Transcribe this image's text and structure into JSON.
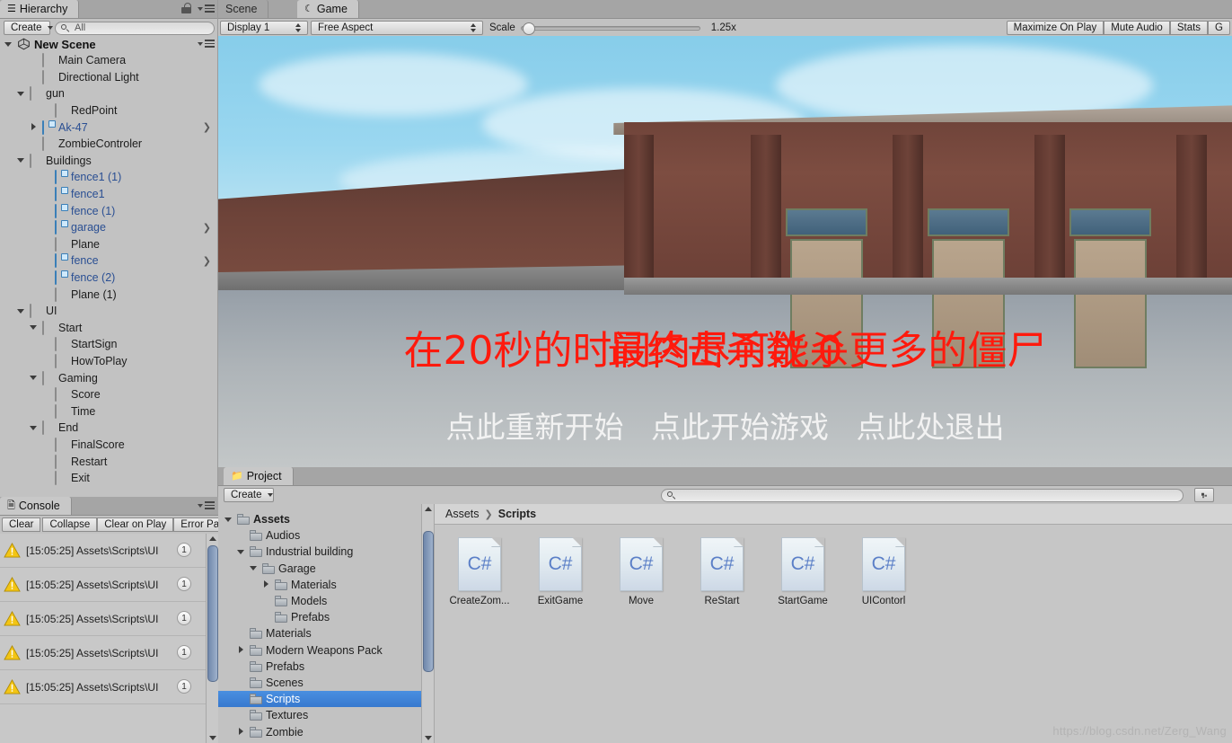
{
  "hierarchy": {
    "tab_label": "Hierarchy",
    "create_button": "Create",
    "search_placeholder": "All",
    "scene_name": "New Scene",
    "items": [
      {
        "label": "Main Camera",
        "depth": 2,
        "fold": "none",
        "icon": "gameobject-icon",
        "prefab": false,
        "chev": false
      },
      {
        "label": "Directional Light",
        "depth": 2,
        "fold": "none",
        "icon": "gameobject-icon",
        "prefab": false,
        "chev": false
      },
      {
        "label": "gun",
        "depth": 1,
        "fold": "open",
        "icon": "gameobject-icon",
        "prefab": false,
        "chev": false
      },
      {
        "label": "RedPoint",
        "depth": 3,
        "fold": "none",
        "icon": "gameobject-icon",
        "prefab": false,
        "chev": false
      },
      {
        "label": "Ak-47",
        "depth": 2,
        "fold": "closed",
        "icon": "prefab-icon",
        "prefab": true,
        "chev": true
      },
      {
        "label": "ZombieControler",
        "depth": 2,
        "fold": "none",
        "icon": "gameobject-icon",
        "prefab": false,
        "chev": false
      },
      {
        "label": "Buildings",
        "depth": 1,
        "fold": "open",
        "icon": "gameobject-icon",
        "prefab": false,
        "chev": false
      },
      {
        "label": "fence1 (1)",
        "depth": 3,
        "fold": "none",
        "icon": "prefab-icon",
        "prefab": true,
        "chev": false
      },
      {
        "label": "fence1",
        "depth": 3,
        "fold": "none",
        "icon": "prefab-icon",
        "prefab": true,
        "chev": false
      },
      {
        "label": "fence (1)",
        "depth": 3,
        "fold": "none",
        "icon": "prefab-icon",
        "prefab": true,
        "chev": false
      },
      {
        "label": "garage",
        "depth": 3,
        "fold": "none",
        "icon": "prefab-icon",
        "prefab": true,
        "chev": true
      },
      {
        "label": "Plane",
        "depth": 3,
        "fold": "none",
        "icon": "gameobject-icon",
        "prefab": false,
        "chev": false
      },
      {
        "label": "fence",
        "depth": 3,
        "fold": "none",
        "icon": "prefab-icon",
        "prefab": true,
        "chev": true
      },
      {
        "label": "fence (2)",
        "depth": 3,
        "fold": "none",
        "icon": "prefab-icon",
        "prefab": true,
        "chev": false
      },
      {
        "label": "Plane (1)",
        "depth": 3,
        "fold": "none",
        "icon": "gameobject-icon",
        "prefab": false,
        "chev": false
      },
      {
        "label": "UI",
        "depth": 1,
        "fold": "open",
        "icon": "gameobject-icon",
        "prefab": false,
        "chev": false
      },
      {
        "label": "Start",
        "depth": 2,
        "fold": "open",
        "icon": "gameobject-icon",
        "prefab": false,
        "chev": false
      },
      {
        "label": "StartSign",
        "depth": 3,
        "fold": "none",
        "icon": "gameobject-icon",
        "prefab": false,
        "chev": false
      },
      {
        "label": "HowToPlay",
        "depth": 3,
        "fold": "none",
        "icon": "gameobject-icon",
        "prefab": false,
        "chev": false
      },
      {
        "label": "Gaming",
        "depth": 2,
        "fold": "open",
        "icon": "gameobject-icon",
        "prefab": false,
        "chev": false
      },
      {
        "label": "Score",
        "depth": 3,
        "fold": "none",
        "icon": "gameobject-icon",
        "prefab": false,
        "chev": false
      },
      {
        "label": "Time",
        "depth": 3,
        "fold": "none",
        "icon": "gameobject-icon",
        "prefab": false,
        "chev": false
      },
      {
        "label": "End",
        "depth": 2,
        "fold": "open",
        "icon": "gameobject-icon",
        "prefab": false,
        "chev": false
      },
      {
        "label": "FinalScore",
        "depth": 3,
        "fold": "none",
        "icon": "gameobject-icon",
        "prefab": false,
        "chev": false
      },
      {
        "label": "Restart",
        "depth": 3,
        "fold": "none",
        "icon": "gameobject-icon",
        "prefab": false,
        "chev": false
      },
      {
        "label": "Exit",
        "depth": 3,
        "fold": "none",
        "icon": "gameobject-icon",
        "prefab": false,
        "chev": false
      }
    ]
  },
  "console": {
    "tab_label": "Console",
    "buttons": [
      "Clear",
      "Collapse",
      "Clear on Play",
      "Error Pause"
    ],
    "rows": [
      {
        "text": "[15:05:25] Assets\\Scripts\\UI",
        "count": "1",
        "type": "warning-icon"
      },
      {
        "text": "[15:05:25] Assets\\Scripts\\UI",
        "count": "1",
        "type": "warning-icon"
      },
      {
        "text": "[15:05:25] Assets\\Scripts\\UI",
        "count": "1",
        "type": "warning-icon"
      },
      {
        "text": "[15:05:25] Assets\\Scripts\\UI",
        "count": "1",
        "type": "warning-icon"
      },
      {
        "text": "[15:05:25] Assets\\Scripts\\UI",
        "count": "1",
        "type": "warning-icon"
      }
    ]
  },
  "gameview": {
    "tabs": [
      {
        "label": "Scene",
        "active": false,
        "icon": "scene-icon"
      },
      {
        "label": "Game",
        "active": true,
        "icon": "game-icon"
      }
    ],
    "display_select": "Display 1",
    "aspect_select": "Free Aspect",
    "scale_label": "Scale",
    "scale_value": "1.25x",
    "maximize_on_play": "Maximize On Play",
    "mute_audio": "Mute Audio",
    "stats": "Stats",
    "gizmos": "G",
    "overlay": {
      "line1_texts": [
        "在20秒的时间内尽可能杀更多的僵尸",
        "最终击杀数 0"
      ],
      "line2_texts": [
        "点此重新开始",
        "点此开始游戏",
        "点此处退出"
      ],
      "line1_color": "#ff1a0d",
      "line2_color": "#f2f2f2"
    }
  },
  "project": {
    "tab_label": "Project",
    "create_button": "Create",
    "search_placeholder": "",
    "breadcrumb": [
      "Assets",
      "Scripts"
    ],
    "tree": [
      {
        "label": "Assets",
        "depth": 0,
        "fold": "open",
        "bold": true,
        "sel": false
      },
      {
        "label": "Audios",
        "depth": 1,
        "fold": "none",
        "bold": false,
        "sel": false
      },
      {
        "label": "Industrial building",
        "depth": 1,
        "fold": "open",
        "bold": false,
        "sel": false
      },
      {
        "label": "Garage",
        "depth": 2,
        "fold": "open",
        "bold": false,
        "sel": false
      },
      {
        "label": "Materials",
        "depth": 3,
        "fold": "closed",
        "bold": false,
        "sel": false
      },
      {
        "label": "Models",
        "depth": 3,
        "fold": "none",
        "bold": false,
        "sel": false
      },
      {
        "label": "Prefabs",
        "depth": 3,
        "fold": "none",
        "bold": false,
        "sel": false
      },
      {
        "label": "Materials",
        "depth": 1,
        "fold": "none",
        "bold": false,
        "sel": false
      },
      {
        "label": "Modern Weapons Pack",
        "depth": 1,
        "fold": "closed",
        "bold": false,
        "sel": false
      },
      {
        "label": "Prefabs",
        "depth": 1,
        "fold": "none",
        "bold": false,
        "sel": false
      },
      {
        "label": "Scenes",
        "depth": 1,
        "fold": "none",
        "bold": false,
        "sel": false
      },
      {
        "label": "Scripts",
        "depth": 1,
        "fold": "none",
        "bold": false,
        "sel": true
      },
      {
        "label": "Textures",
        "depth": 1,
        "fold": "none",
        "bold": false,
        "sel": false
      },
      {
        "label": "Zombie",
        "depth": 1,
        "fold": "closed",
        "bold": false,
        "sel": false
      }
    ],
    "assets": [
      {
        "name": "CreateZom...",
        "badge": "C#"
      },
      {
        "name": "ExitGame",
        "badge": "C#"
      },
      {
        "name": "Move",
        "badge": "C#"
      },
      {
        "name": "ReStart",
        "badge": "C#"
      },
      {
        "name": "StartGame",
        "badge": "C#"
      },
      {
        "name": "UIContorl",
        "badge": "C#"
      }
    ]
  },
  "watermark": "https://blog.csdn.net/Zerg_Wang",
  "colors": {
    "chrome": "#c2c2c2",
    "tabstrip": "#a5a5a5",
    "selection": "#3879cf",
    "prefab_text": "#2a4f93",
    "warning": "#f2c511",
    "csharp_blue": "#5b7fc7"
  }
}
